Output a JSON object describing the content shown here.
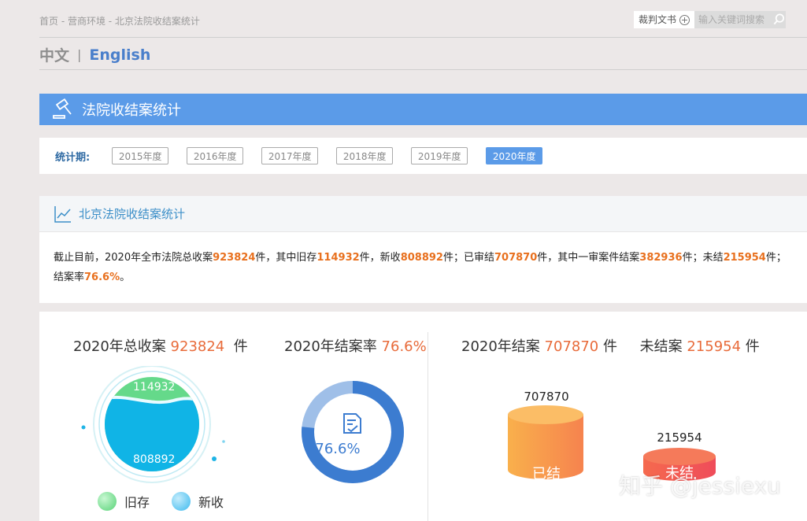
{
  "breadcrumb": "首页 - 营商环境 - 北京法院收结案统计",
  "top": {
    "judge_doc_label": "裁判文书",
    "search_placeholder": "输入关键词搜索"
  },
  "lang": {
    "zh": "中文",
    "sep": "|",
    "en": "English"
  },
  "section_title": "法院收结案统计",
  "period": {
    "label": "统计期:",
    "years": [
      "2015年度",
      "2016年度",
      "2017年度",
      "2018年度",
      "2019年度",
      "2020年度"
    ],
    "active_index": 5
  },
  "card": {
    "title": "北京法院收结案统计",
    "summary": {
      "p1": "截止目前，2020年全市法院总收案",
      "total": "923824",
      "p2": "件，其中旧存",
      "old": "114932",
      "p3": "件，新收",
      "new": "808892",
      "p4": "件；已审结",
      "closed": "707870",
      "p5": "件，其中一审案件结案",
      "first_instance": "382936",
      "p6": "件；未结",
      "open": "215954",
      "p7": "件；结案率",
      "rate": "76.6%",
      "p8": "。"
    }
  },
  "stats": {
    "total_title": "2020年总收案",
    "total_value": "923824",
    "unit": "件",
    "rate_title": "2020年结案率",
    "rate_value": "76.6%",
    "rate_fraction": 0.766,
    "closed_title": "2020年结案",
    "closed_value": "707870",
    "open_title": "未结案",
    "open_value": "215954",
    "pool_old": "114932",
    "pool_new": "808892",
    "legend_old": "旧存",
    "legend_new": "新收",
    "cyl_closed_value": "707870",
    "cyl_closed_label": "已结",
    "cyl_open_value": "215954",
    "cyl_open_label": "未结"
  },
  "colors": {
    "header_blue": "#5b9be8",
    "highlight_orange": "#e8701e",
    "donut_blue": "#3c7cd0"
  },
  "watermark": "知乎 @jessiexu"
}
